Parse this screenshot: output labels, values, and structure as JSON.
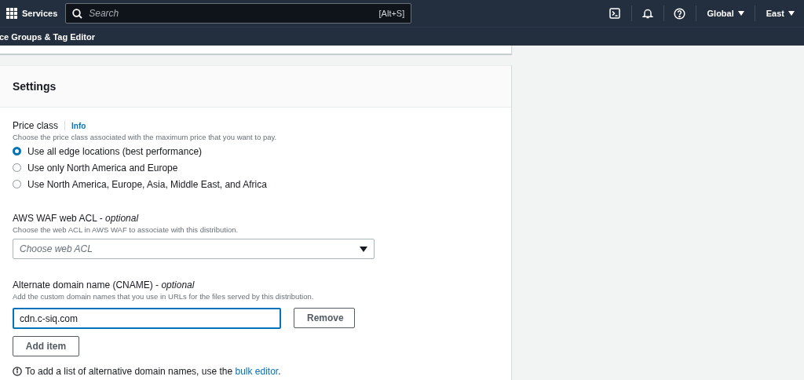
{
  "top_nav": {
    "services_label": "Services",
    "search": {
      "placeholder": "Search",
      "shortcut": "[Alt+S]"
    },
    "menus": [
      {
        "label": "Global"
      },
      {
        "label": "East"
      }
    ]
  },
  "breadcrumb": "ce Groups & Tag Editor",
  "settings": {
    "title": "Settings",
    "price_class": {
      "label": "Price class",
      "info_link": "Info",
      "description": "Choose the price class associated with the maximum price that you want to pay.",
      "options": [
        {
          "label": "Use all edge locations (best performance)",
          "selected": true
        },
        {
          "label": "Use only North America and Europe",
          "selected": false
        },
        {
          "label": "Use North America, Europe, Asia, Middle East, and Africa",
          "selected": false
        }
      ]
    },
    "waf": {
      "label": "AWS WAF web ACL - *optional*",
      "description": "Choose the web ACL in AWS WAF to associate with this distribution.",
      "select": {
        "placeholder": "Choose web ACL"
      }
    },
    "cname": {
      "label": "Alternate domain name (CNAME) - *optional*",
      "description": "Add the custom domain names that you use in URLs for the files served by this distribution.",
      "items": [
        {
          "value": "cdn.c-siq.com",
          "focused": true,
          "remove_button": "Remove"
        }
      ],
      "add_button": "Add item",
      "hint": {
        "text": "To add a list of alternative domain names, use the ",
        "link": "bulk editor",
        "suffix": "."
      }
    }
  }
}
